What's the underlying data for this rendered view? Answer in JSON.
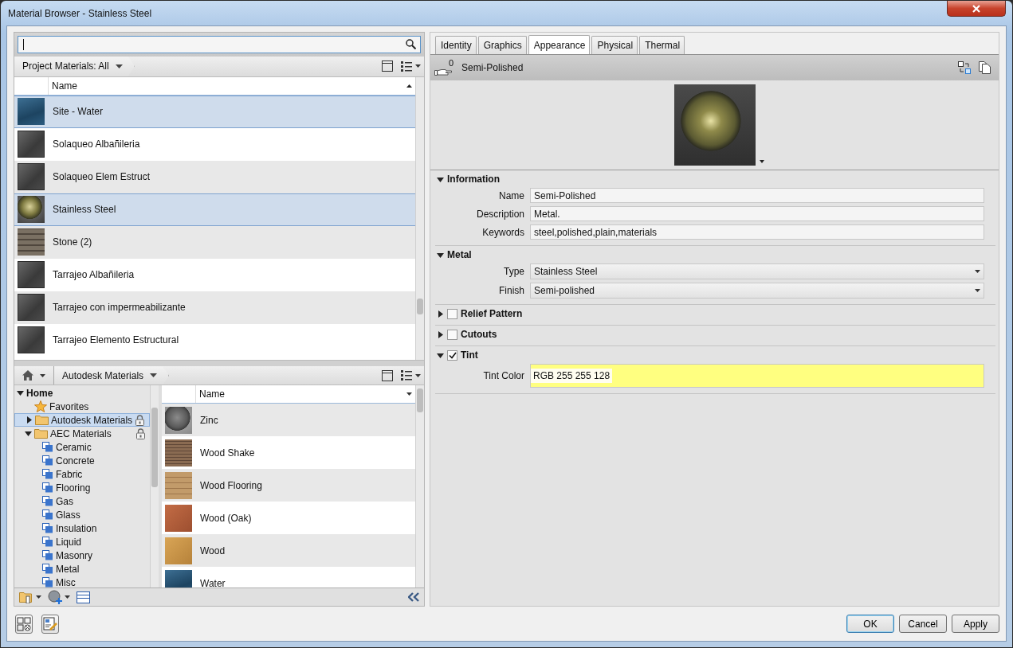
{
  "window": {
    "title": "Material Browser - Stainless Steel"
  },
  "project_materials": {
    "breadcrumb": "Project Materials: All",
    "column": "Name",
    "rows": [
      {
        "name": "Site - Water",
        "kind": "water",
        "selected": true
      },
      {
        "name": "Solaqueo Albañileria",
        "kind": "block",
        "selected": false
      },
      {
        "name": "Solaqueo Elem Estruct",
        "kind": "block",
        "selected": false
      },
      {
        "name": "Stainless Steel",
        "kind": "metal-sphere",
        "selected": true
      },
      {
        "name": "Stone (2)",
        "kind": "stone",
        "selected": false
      },
      {
        "name": "Tarrajeo Albañileria",
        "kind": "block",
        "selected": false
      },
      {
        "name": "Tarrajeo con impermeabilizante",
        "kind": "block",
        "selected": false
      },
      {
        "name": "Tarrajeo Elemento Estructural",
        "kind": "block",
        "selected": false
      }
    ]
  },
  "library": {
    "breadcrumb": "Autodesk Materials",
    "tree": [
      {
        "label": "Home",
        "kind": "home",
        "expanded": true,
        "selected": false,
        "children": [
          {
            "label": "Favorites",
            "kind": "star",
            "selected": false
          },
          {
            "label": "Autodesk Materials",
            "kind": "folder",
            "expanded": false,
            "locked": true,
            "selected": true
          },
          {
            "label": "AEC Materials",
            "kind": "folder",
            "expanded": true,
            "locked": true,
            "selected": false,
            "children": [
              {
                "label": "Ceramic",
                "kind": "category",
                "selected": false
              },
              {
                "label": "Concrete",
                "kind": "category",
                "selected": false
              },
              {
                "label": "Fabric",
                "kind": "category",
                "selected": false
              },
              {
                "label": "Flooring",
                "kind": "category",
                "selected": false
              },
              {
                "label": "Gas",
                "kind": "category",
                "selected": false
              },
              {
                "label": "Glass",
                "kind": "category",
                "selected": false
              },
              {
                "label": "Insulation",
                "kind": "category",
                "selected": false
              },
              {
                "label": "Liquid",
                "kind": "category",
                "selected": false
              },
              {
                "label": "Masonry",
                "kind": "category",
                "selected": false
              },
              {
                "label": "Metal",
                "kind": "category",
                "selected": false
              },
              {
                "label": "Misc",
                "kind": "category",
                "selected": false
              }
            ]
          }
        ]
      }
    ],
    "column": "Name",
    "rows": [
      {
        "name": "Zinc",
        "kind": "sphere"
      },
      {
        "name": "Wood Shake",
        "kind": "shake"
      },
      {
        "name": "Wood Flooring",
        "kind": "flooring"
      },
      {
        "name": "Wood (Oak)",
        "kind": "oak"
      },
      {
        "name": "Wood",
        "kind": "wood"
      },
      {
        "name": "Water",
        "kind": "water"
      }
    ]
  },
  "tabs": [
    {
      "label": "Identity",
      "selected": false
    },
    {
      "label": "Graphics",
      "selected": false
    },
    {
      "label": "Appearance",
      "selected": true
    },
    {
      "label": "Physical",
      "selected": false
    },
    {
      "label": "Thermal",
      "selected": false
    }
  ],
  "asset": {
    "count": "0",
    "name": "Semi-Polished"
  },
  "sections": [
    {
      "title": "Information",
      "expanded": true,
      "fields": [
        {
          "label": "Name",
          "value": "Semi-Polished",
          "kind": "text"
        },
        {
          "label": "Description",
          "value": "Metal.",
          "kind": "text"
        },
        {
          "label": "Keywords",
          "value": "steel,polished,plain,materials",
          "kind": "text"
        }
      ]
    },
    {
      "title": "Metal",
      "expanded": true,
      "fields": [
        {
          "label": "Type",
          "value": "Stainless Steel",
          "kind": "dropdown"
        },
        {
          "label": "Finish",
          "value": "Semi-polished",
          "kind": "dropdown"
        }
      ]
    },
    {
      "title": "Relief Pattern",
      "expanded": false,
      "checked": false
    },
    {
      "title": "Cutouts",
      "expanded": false,
      "checked": false
    },
    {
      "title": "Tint",
      "expanded": true,
      "checked": true,
      "fields": [
        {
          "label": "Tint Color",
          "value": "RGB 255 255 128",
          "kind": "color",
          "color": "#ffff80"
        }
      ]
    }
  ],
  "buttons": [
    {
      "label": "OK",
      "default": true
    },
    {
      "label": "Cancel",
      "default": false
    },
    {
      "label": "Apply",
      "default": false
    }
  ]
}
